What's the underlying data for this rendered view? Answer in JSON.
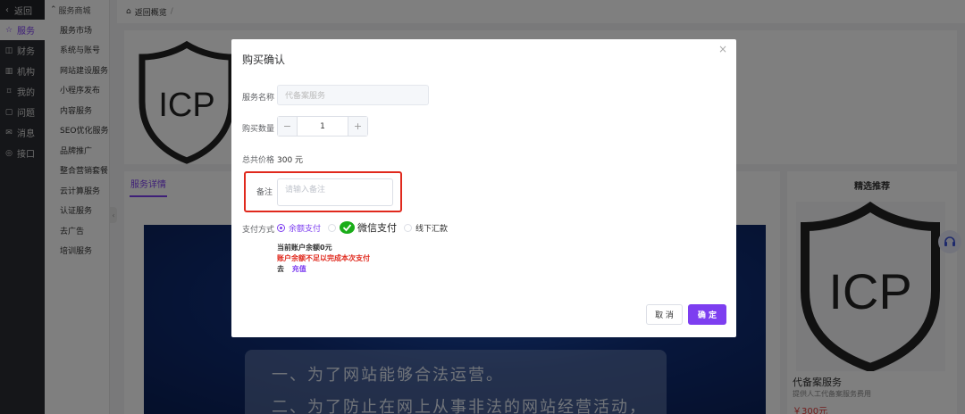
{
  "nav": {
    "back": "返回",
    "items": [
      {
        "label": "服务",
        "icon": "star-icon",
        "active": true
      },
      {
        "label": "财务",
        "icon": "wallet-icon",
        "active": false
      },
      {
        "label": "机构",
        "icon": "building-icon",
        "active": false
      },
      {
        "label": "我的",
        "icon": "bookmark-icon",
        "active": false
      },
      {
        "label": "问题",
        "icon": "question-icon",
        "active": false
      },
      {
        "label": "消息",
        "icon": "mail-icon",
        "active": false
      },
      {
        "label": "接口",
        "icon": "api-icon",
        "active": false
      }
    ]
  },
  "subnav": {
    "head": "服务商城",
    "items": [
      "服务市场",
      "系统与账号",
      "网站建设服务",
      "小程序发布",
      "内容服务",
      "SEO优化服务",
      "品牌推广",
      "整合营销套餐",
      "云计算服务",
      "认证服务",
      "去广告",
      "培训服务"
    ]
  },
  "breadcrumb": {
    "text": "返回概览",
    "sep": "/"
  },
  "logo": {
    "text": "ICP"
  },
  "detail": {
    "tab": "服务详情",
    "banner_lines": [
      "一、为了网站能够合法运营。",
      "二、为了防止在网上从事非法的网站经营活动，"
    ]
  },
  "recommend": {
    "title": "精选推荐",
    "name": "代备案服务",
    "desc": "提供人工代备案服务费用",
    "price": "￥300元"
  },
  "modal": {
    "title": "购买确认",
    "close": "×",
    "service_label": "服务名称",
    "service_placeholder": "代备案服务",
    "qty_label": "购买数量",
    "qty_minus": "−",
    "qty_value": "1",
    "qty_plus": "+",
    "price_label": "总共价格",
    "price_value": "300 元",
    "remark_label": "备注",
    "remark_placeholder": "请输入备注",
    "pay_label": "支付方式",
    "pay_options": [
      {
        "label": "余额支付",
        "selected": true
      },
      {
        "label": "微信支付",
        "selected": false
      },
      {
        "label": "线下汇款",
        "selected": false
      }
    ],
    "balance_text": "当前账户余额0元",
    "insufficient_text": "账户余额不足以完成本次支付",
    "recharge_prefix": "去",
    "recharge_link": "充值",
    "cancel": "取 消",
    "confirm": "确 定"
  },
  "colors": {
    "accent": "#7d3ef0",
    "alert": "#e0291d",
    "wechat": "#1aad19",
    "nav_bg": "#2b2d33"
  }
}
